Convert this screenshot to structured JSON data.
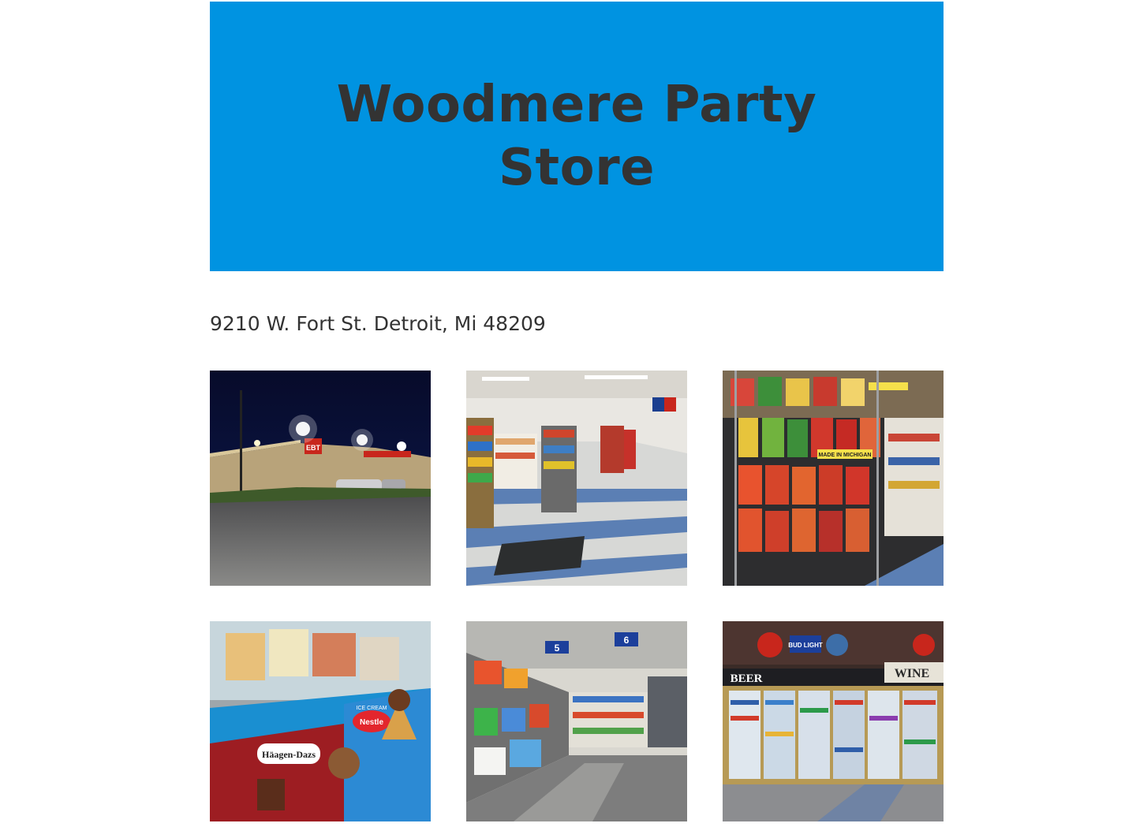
{
  "site": {
    "title": "Woodmere Party Store",
    "address": "9210 W. Fort St. Detroit, Mi 48209",
    "hero_color": "#0093e1"
  },
  "gallery": {
    "photos": [
      {
        "subject": "store-exterior-night",
        "sign_text": "EBT"
      },
      {
        "subject": "store-interior-aisles",
        "sign_text": ""
      },
      {
        "subject": "chips-snack-rack",
        "sign_text": "MADE IN MICHIGAN"
      },
      {
        "subject": "ice-cream-freezer",
        "brand1": "Häagen-Dazs",
        "brand2": "Nestle",
        "brand3": "ICE CREAM"
      },
      {
        "subject": "household-aisle",
        "aisle1": "5",
        "aisle2": "6"
      },
      {
        "subject": "beer-wine-coolers",
        "label1": "BEER",
        "label2": "WINE",
        "label3": "BUD LIGHT"
      }
    ]
  }
}
